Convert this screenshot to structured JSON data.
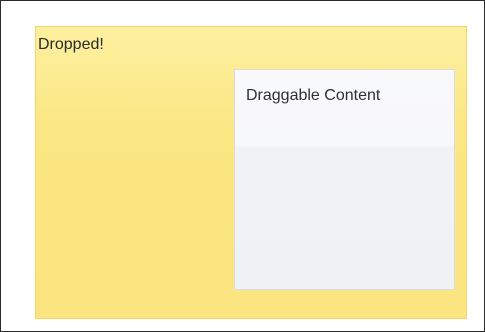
{
  "drop_zone": {
    "status_text": "Dropped!"
  },
  "draggable": {
    "label": "Draggable Content"
  },
  "colors": {
    "drop_zone_fill": "#fbe783",
    "drop_zone_border": "#efd76a",
    "draggable_fill": "#f3f5f8",
    "draggable_border": "#d9dbe0",
    "frame_border": "#2b2b2b"
  }
}
